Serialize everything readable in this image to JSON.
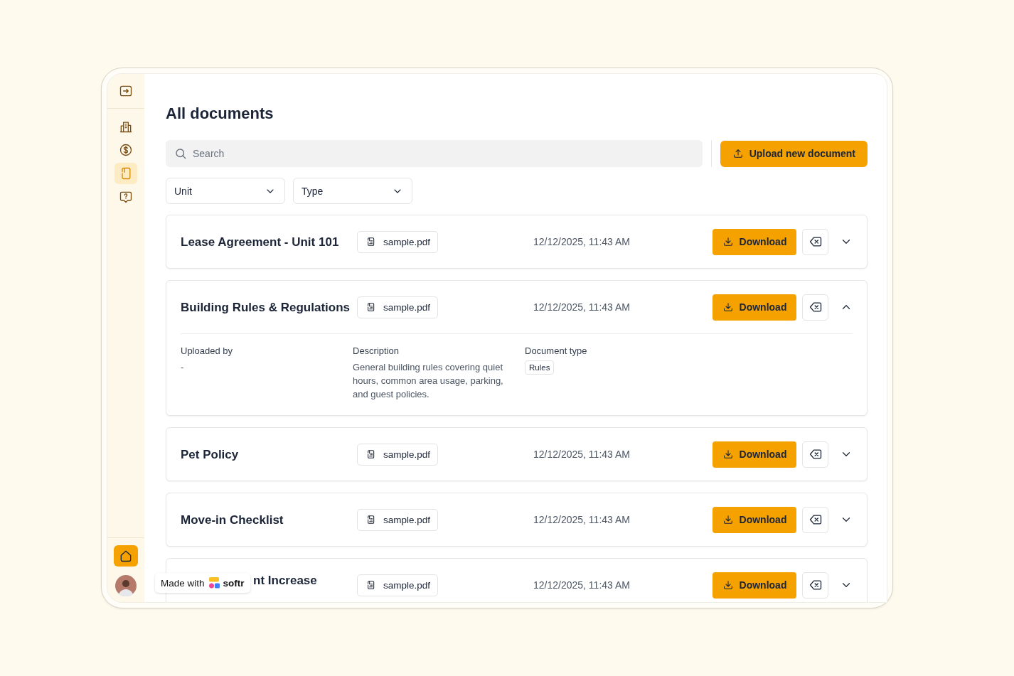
{
  "sidebar": {
    "top_items": [
      {
        "kind": "collapse",
        "selected": false
      }
    ],
    "items": [
      {
        "kind": "building",
        "selected": false
      },
      {
        "kind": "dollar",
        "selected": false
      },
      {
        "kind": "document",
        "selected": true
      },
      {
        "kind": "help",
        "selected": false
      }
    ],
    "bottom_items": [
      {
        "kind": "home",
        "selected": true
      }
    ],
    "avatar": {
      "kind": "avatar"
    }
  },
  "page_title": "All documents",
  "search": {
    "placeholder": "Search"
  },
  "upload_button": "Upload new document",
  "filters": [
    {
      "label": "Unit"
    },
    {
      "label": "Type"
    }
  ],
  "documents": [
    {
      "title": "Lease Agreement - Unit 101",
      "file": "sample.pdf",
      "date": "12/12/2025, 11:43 AM",
      "action": "Download",
      "expanded": false
    },
    {
      "title": "Building Rules & Regulations",
      "file": "sample.pdf",
      "date": "12/12/2025, 11:43 AM",
      "action": "Download",
      "expanded": true,
      "details": [
        {
          "kind": "text",
          "label": "Uploaded by",
          "value": "-"
        },
        {
          "kind": "text",
          "label": "Description",
          "value": "General building rules covering quiet hours, common area usage, parking, and guest policies."
        },
        {
          "kind": "tag",
          "label": "Document type",
          "value": "Rules"
        }
      ]
    },
    {
      "title": "Pet Policy",
      "file": "sample.pdf",
      "date": "12/12/2025, 11:43 AM",
      "action": "Download",
      "expanded": false
    },
    {
      "title": "Move-in Checklist",
      "file": "sample.pdf",
      "date": "12/12/2025, 11:43 AM",
      "action": "Download",
      "expanded": false
    },
    {
      "title": "nt Increase",
      "covered": true,
      "file": "sample.pdf",
      "date": "12/12/2025, 11:43 AM",
      "action": "Download",
      "expanded": false
    }
  ],
  "badge": {
    "prefix": "Made with",
    "brand": "softr"
  }
}
